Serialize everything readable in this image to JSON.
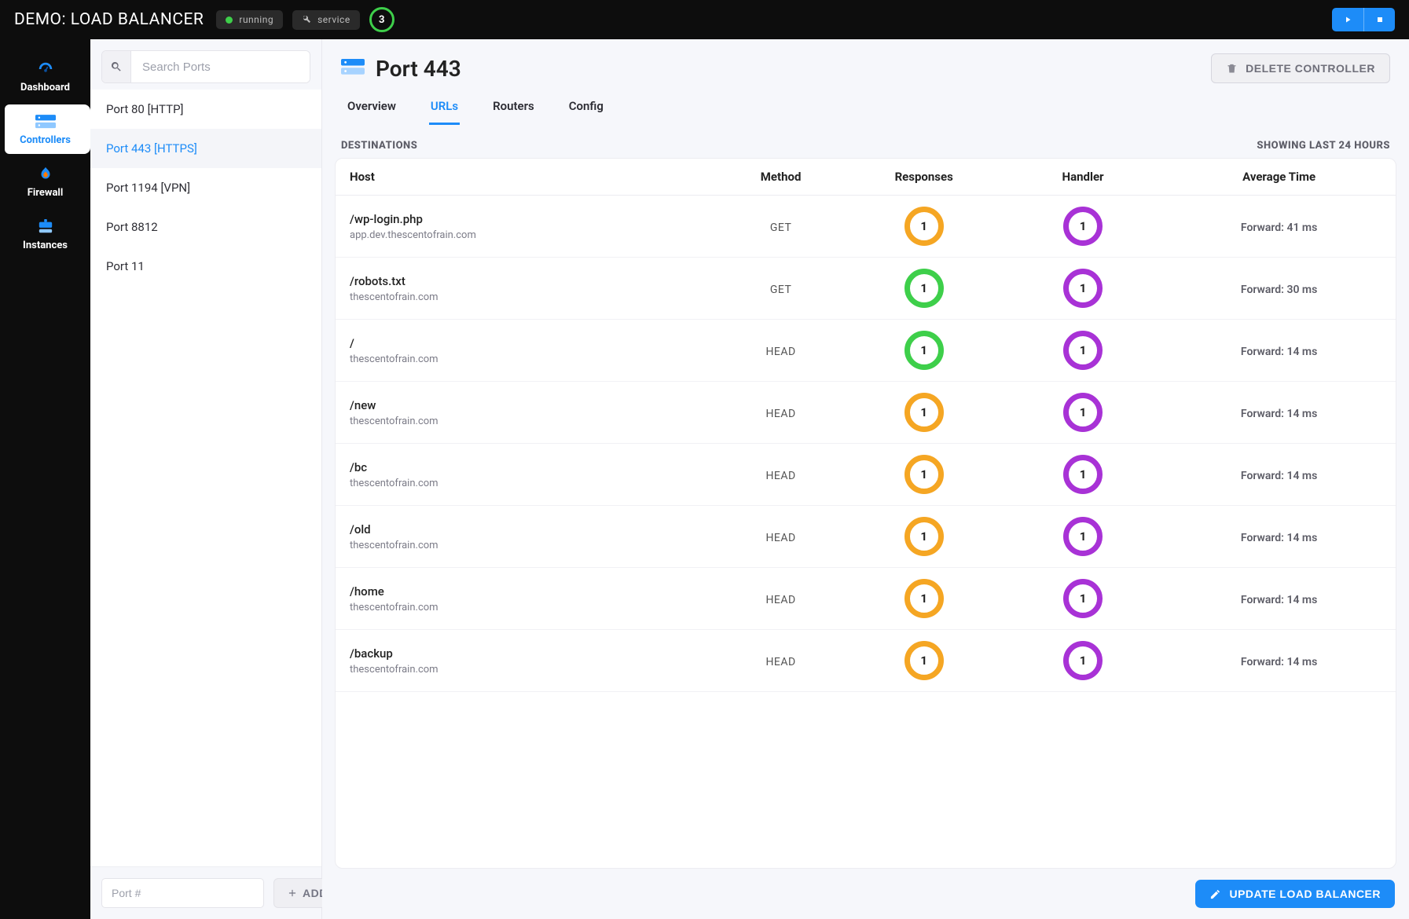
{
  "topbar": {
    "title": "DEMO: LOAD BALANCER",
    "status_label": "running",
    "type_label": "service",
    "count": "3"
  },
  "nav": {
    "items": [
      {
        "label": "Dashboard",
        "icon": "dashboard-icon",
        "active": false
      },
      {
        "label": "Controllers",
        "icon": "controllers-icon",
        "active": true
      },
      {
        "label": "Firewall",
        "icon": "firewall-icon",
        "active": false
      },
      {
        "label": "Instances",
        "icon": "instances-icon",
        "active": false
      }
    ]
  },
  "ports": {
    "search_placeholder": "Search Ports",
    "items": [
      {
        "label": "Port 80 [HTTP]",
        "selected": false
      },
      {
        "label": "Port 443 [HTTPS]",
        "selected": true
      },
      {
        "label": "Port 1194 [VPN]",
        "selected": false
      },
      {
        "label": "Port 8812",
        "selected": false
      },
      {
        "label": "Port 11",
        "selected": false
      }
    ],
    "add_placeholder": "Port #",
    "add_label": "ADD"
  },
  "main": {
    "title": "Port 443",
    "delete_label": "DELETE CONTROLLER",
    "tabs": [
      {
        "label": "Overview",
        "active": false
      },
      {
        "label": "URLs",
        "active": true
      },
      {
        "label": "Routers",
        "active": false
      },
      {
        "label": "Config",
        "active": false
      }
    ],
    "section_title": "DESTINATIONS",
    "range_label": "SHOWING LAST 24 HOURS",
    "columns": {
      "host": "Host",
      "method": "Method",
      "responses": "Responses",
      "handler": "Handler",
      "avg": "Average Time"
    },
    "rows": [
      {
        "path": "/wp-login.php",
        "domain": "app.dev.thescentofrain.com",
        "method": "GET",
        "responses": "1",
        "resp_color": "orange",
        "handler": "1",
        "avg": "Forward: 41 ms"
      },
      {
        "path": "/robots.txt",
        "domain": "thescentofrain.com",
        "method": "GET",
        "responses": "1",
        "resp_color": "green",
        "handler": "1",
        "avg": "Forward: 30 ms"
      },
      {
        "path": "/",
        "domain": "thescentofrain.com",
        "method": "HEAD",
        "responses": "1",
        "resp_color": "green",
        "handler": "1",
        "avg": "Forward: 14 ms"
      },
      {
        "path": "/new",
        "domain": "thescentofrain.com",
        "method": "HEAD",
        "responses": "1",
        "resp_color": "orange",
        "handler": "1",
        "avg": "Forward: 14 ms"
      },
      {
        "path": "/bc",
        "domain": "thescentofrain.com",
        "method": "HEAD",
        "responses": "1",
        "resp_color": "orange",
        "handler": "1",
        "avg": "Forward: 14 ms"
      },
      {
        "path": "/old",
        "domain": "thescentofrain.com",
        "method": "HEAD",
        "responses": "1",
        "resp_color": "orange",
        "handler": "1",
        "avg": "Forward: 14 ms"
      },
      {
        "path": "/home",
        "domain": "thescentofrain.com",
        "method": "HEAD",
        "responses": "1",
        "resp_color": "orange",
        "handler": "1",
        "avg": "Forward: 14 ms"
      },
      {
        "path": "/backup",
        "domain": "thescentofrain.com",
        "method": "HEAD",
        "responses": "1",
        "resp_color": "orange",
        "handler": "1",
        "avg": "Forward: 14 ms"
      }
    ],
    "update_label": "UPDATE LOAD BALANCER"
  }
}
